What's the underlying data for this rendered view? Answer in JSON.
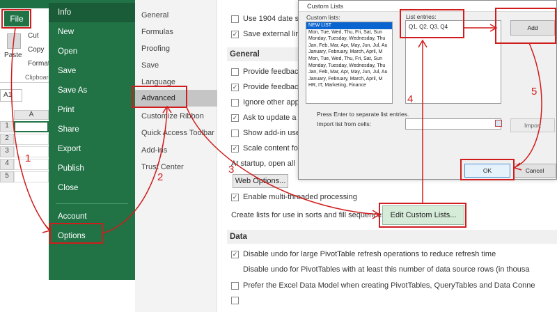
{
  "excel": {
    "file_tab": "File",
    "ribbon": {
      "cut": "Cut",
      "copy": "Copy",
      "format": "Format",
      "paste": "Paste",
      "clipboard": "Clipboard"
    },
    "name_box": "A1",
    "column_header": "A",
    "row_headers": [
      "1",
      "2",
      "3",
      "4",
      "5"
    ]
  },
  "backstage": {
    "items": [
      "Info",
      "New",
      "Open",
      "Save",
      "Save As",
      "Print",
      "Share",
      "Export",
      "Publish",
      "Close"
    ],
    "account": "Account",
    "options": "Options",
    "active_color": "#217346"
  },
  "options_nav": {
    "items": [
      "General",
      "Formulas",
      "Proofing",
      "Save",
      "Language",
      "Advanced",
      "Customize Ribbon",
      "Quick Access Toolbar",
      "Add-ins",
      "Trust Center"
    ],
    "selected": "Advanced"
  },
  "advanced": {
    "top_rows": [
      {
        "label": "Use 1904 date sy",
        "checked": false
      },
      {
        "label": "Save external lin",
        "checked": true
      }
    ],
    "general_header": "General",
    "general_rows": [
      {
        "label": "Provide feedbac",
        "checked": false
      },
      {
        "label": "Provide feedbac",
        "checked": true
      },
      {
        "label": "Ignore other app",
        "checked": false
      },
      {
        "label": "Ask to update a",
        "checked": true
      },
      {
        "label": "Show add-in use",
        "checked": false
      },
      {
        "label": "Scale content fo",
        "checked": true
      }
    ],
    "startup_text": "At startup, open all",
    "web_options_button": "Web Options...",
    "multithread_label": "Enable multi-threaded processing",
    "custom_lists_text": "Create lists for use in sorts and fill sequences:",
    "edit_custom_lists_button": "Edit Custom Lists...",
    "data_header": "Data",
    "data_rows": [
      {
        "label": "Disable undo for large PivotTable refresh operations to reduce refresh time",
        "checked": true
      },
      {
        "label": "Disable undo for PivotTables with at least this number of data source rows (in thousa",
        "checked": null
      },
      {
        "label": "Prefer the Excel Data Model when creating PivotTables, QueryTables and Data Conne",
        "checked": false
      }
    ]
  },
  "custom_lists": {
    "title": "Custom Lists",
    "lists_label": "Custom lists:",
    "entries_label": "List entries:",
    "lists": [
      "NEW LIST",
      "Mon, Tue, Wed, Thu, Fri, Sat, Sun",
      "Monday, Tuesday, Wednesday, Thu",
      "Jan, Feb, Mar, Apr, May, Jun, Jul, Au",
      "January, February, March, April, M",
      "Mon, Tue, Wed, Thu, Fri, Sat, Sun",
      "Monday, Tuesday, Wednesday, Thu",
      "Jan, Feb, Mar, Apr, May, Jun, Jul, Au",
      "January, February, March, April, M",
      "HR, IT, Marketing, Finance"
    ],
    "entries_value": "Q1, Q2, Q3, Q4",
    "add_button": "Add",
    "hint": "Press Enter to separate list entries.",
    "import_label": "Import list from cells:",
    "import_button": "Import",
    "ok_button": "OK",
    "cancel_button": "Cancel"
  },
  "annotations": {
    "steps": [
      "1",
      "2",
      "3",
      "4",
      "5"
    ],
    "color": "#d01c1c"
  }
}
